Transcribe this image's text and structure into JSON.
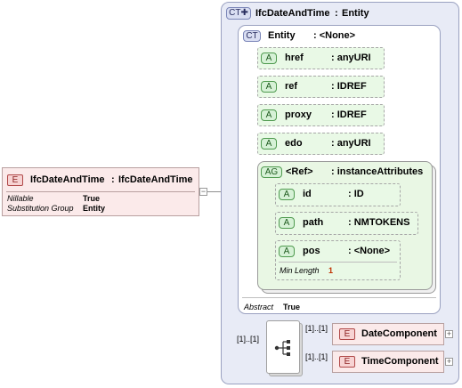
{
  "diagram": {
    "main_element": {
      "badge": "E",
      "name": "IfcDateAndTime",
      "separator": ":",
      "type": "IfcDateAndTime",
      "props": [
        {
          "key": "Nillable",
          "value": "True"
        },
        {
          "key": "Substitution Group",
          "value": "Entity"
        }
      ]
    },
    "complex_type": {
      "badge": "CT",
      "name": "IfcDateAndTime",
      "separator": ":",
      "base": "Entity",
      "entity": {
        "badge": "CT",
        "name": "Entity",
        "type": ": <None>",
        "attributes": [
          {
            "badge": "A",
            "name": "href",
            "type": ": anyURI"
          },
          {
            "badge": "A",
            "name": "ref",
            "type": ": IDREF"
          },
          {
            "badge": "A",
            "name": "proxy",
            "type": ": IDREF"
          },
          {
            "badge": "A",
            "name": "edo",
            "type": ": anyURI"
          }
        ],
        "attribute_group": {
          "badge": "AG",
          "name": "<Ref>",
          "type": ": instanceAttributes",
          "attributes": [
            {
              "badge": "A",
              "name": "id",
              "type": ": ID"
            },
            {
              "badge": "A",
              "name": "path",
              "type": ": NMTOKENS"
            },
            {
              "badge": "A",
              "name": "pos",
              "type": ": <None>",
              "facet_key": "Min Length",
              "facet_value": "1"
            }
          ]
        },
        "abstract_key": "Abstract",
        "abstract_value": "True"
      },
      "sequence_multiplicity": "[1]..[1]",
      "children": [
        {
          "badge": "E",
          "name": "DateComponent",
          "multiplicity": "[1]..[1]"
        },
        {
          "badge": "E",
          "name": "TimeComponent",
          "multiplicity": "[1]..[1]"
        }
      ]
    },
    "colors": {
      "element": "#f7d3d3",
      "attribute": "#d6f1d6",
      "complex_type": "#d9def2"
    }
  }
}
